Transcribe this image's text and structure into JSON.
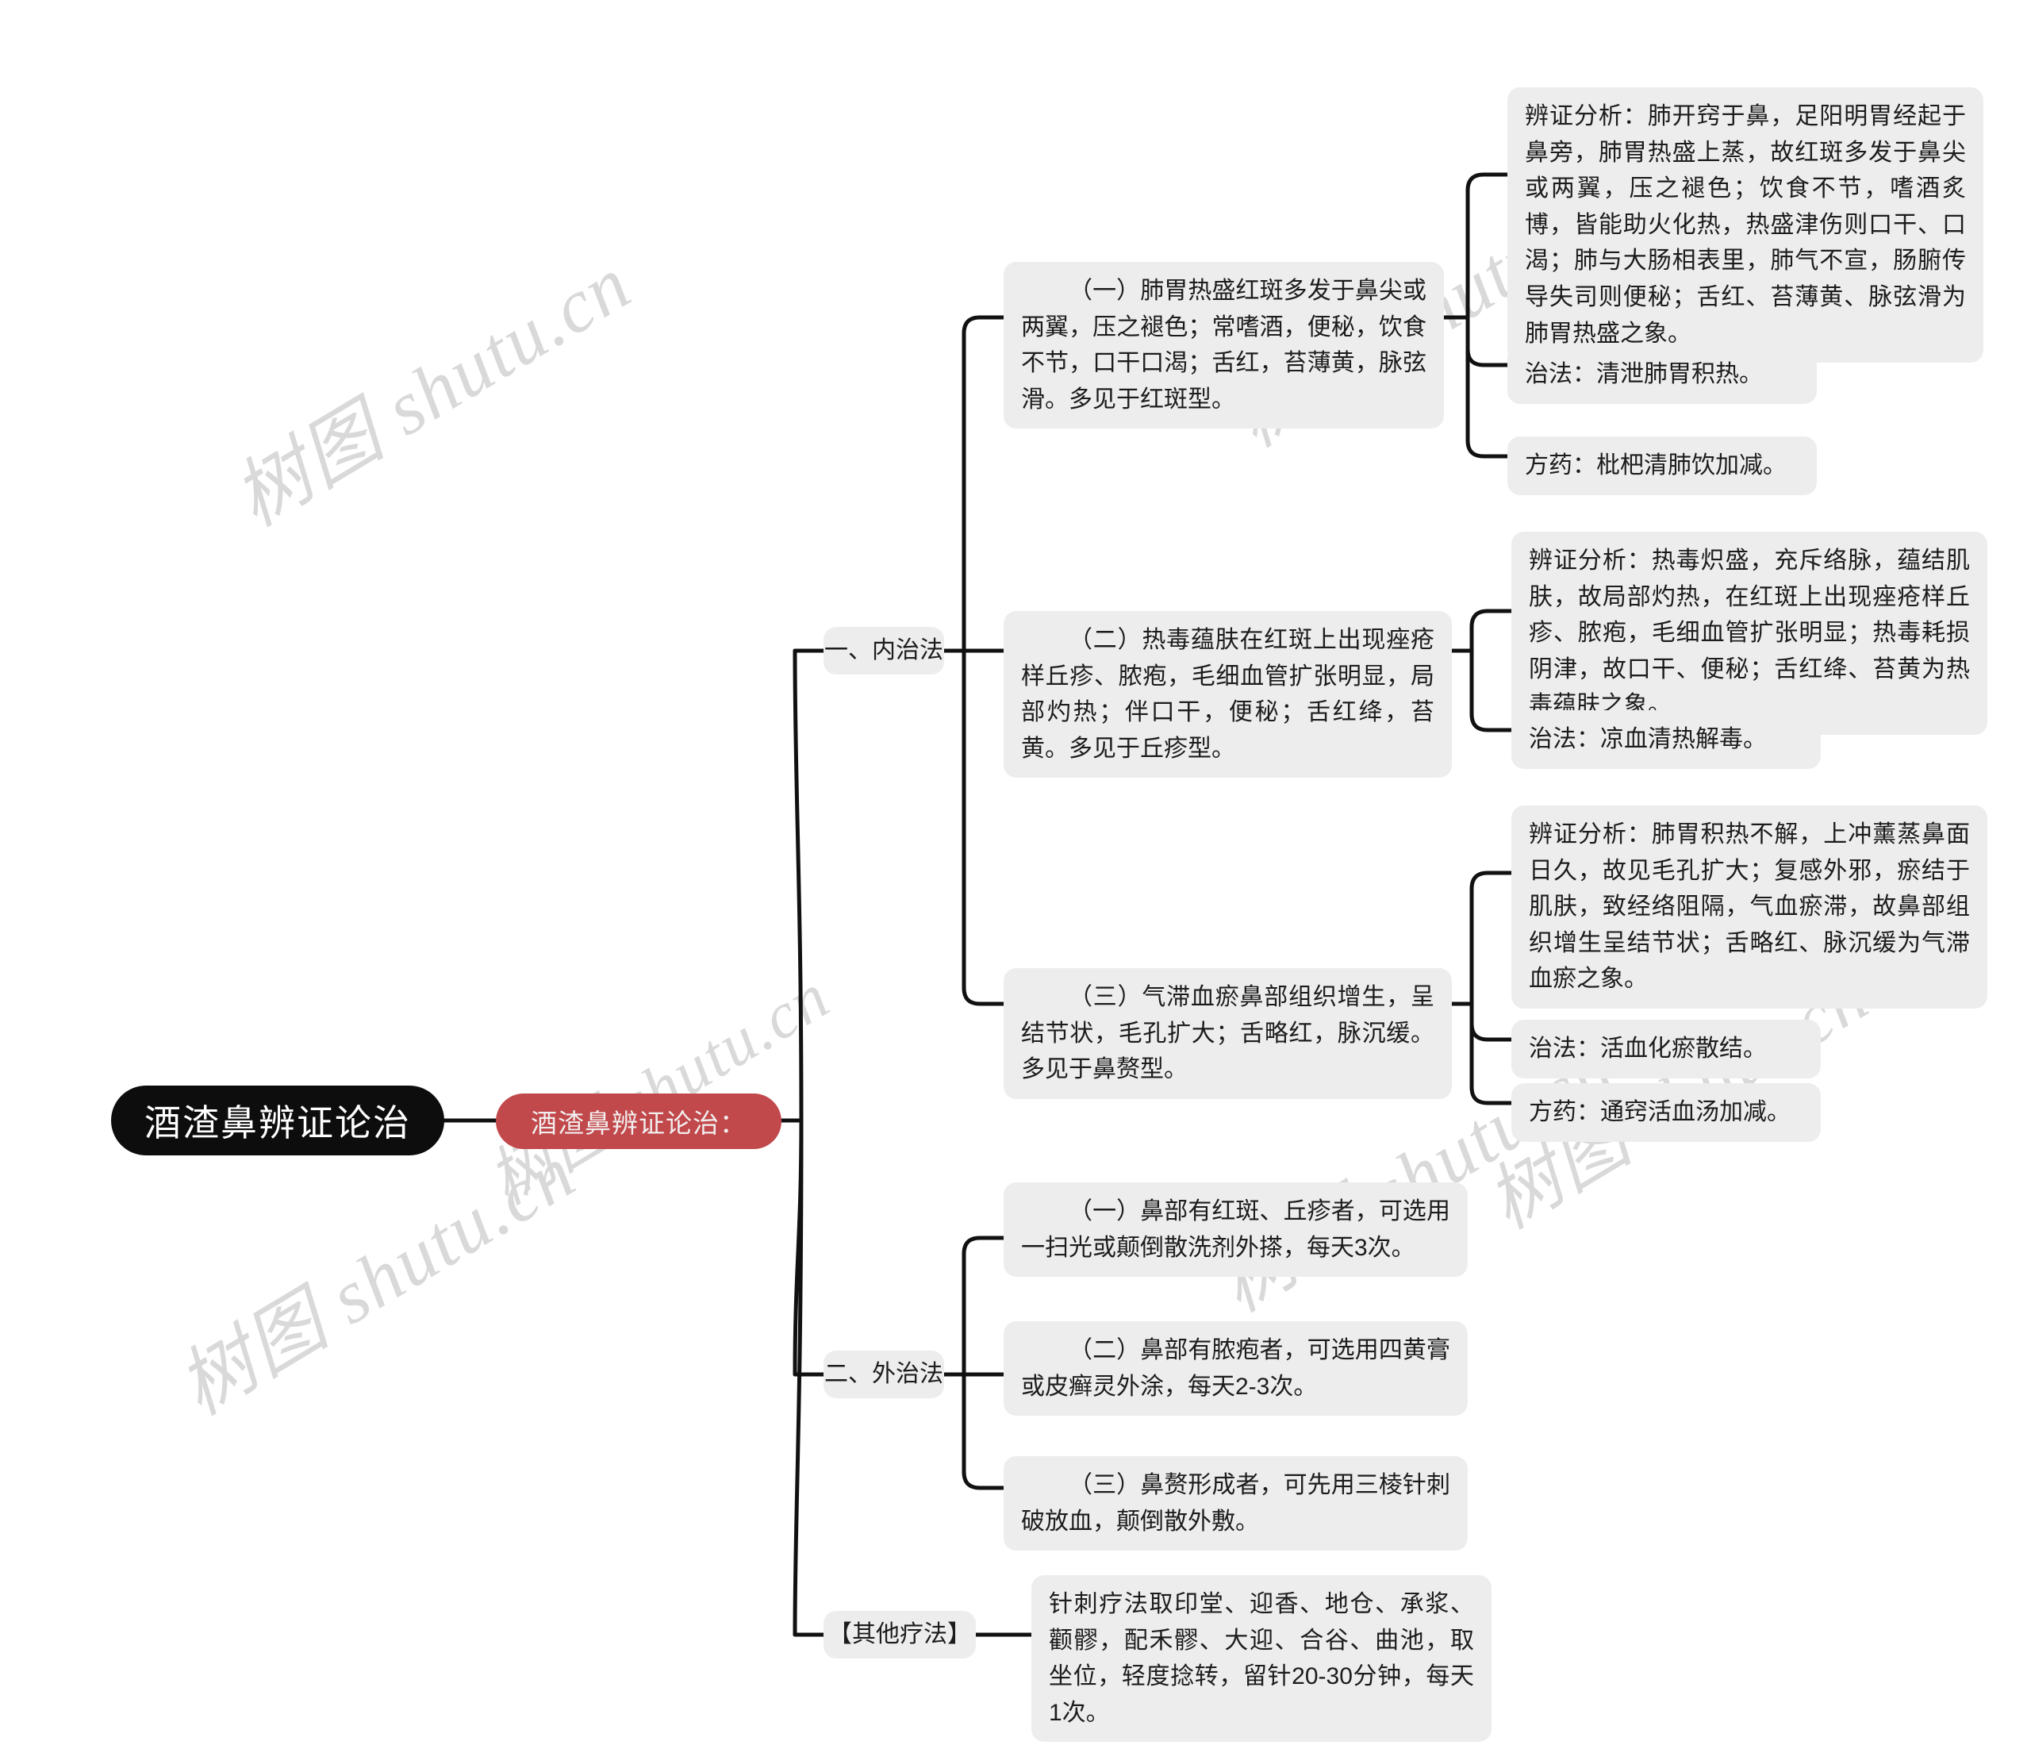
{
  "watermark": {
    "text": "树图 shutu.cn",
    "color": "#d9d9d9"
  },
  "theme": {
    "root_bg": "#0d0d0d",
    "root_fg": "#ffffff",
    "accent_bg": "#c1484b",
    "accent_fg": "#f2eeee",
    "node_bg": "#ededed",
    "node_fg": "#1c1c1c",
    "link": "#111111"
  },
  "root": {
    "label": "酒渣鼻辨证论治"
  },
  "topic": {
    "label": "酒渣鼻辨证论治："
  },
  "branches": [
    {
      "label": "一、内治法",
      "items": [
        {
          "text": "（一）肺胃热盛红斑多发于鼻尖或两翼，压之褪色；常嗜酒，便秘，饮食不节，口干口渴；舌红，苔薄黄，脉弦滑。多见于红斑型。",
          "details": [
            "辨证分析：肺开窍于鼻，足阳明胃经起于鼻旁，肺胃热盛上蒸，故红斑多发于鼻尖或两翼，压之褪色；饮食不节，嗜酒炙博，皆能助火化热，热盛津伤则口干、口渴；肺与大肠相表里，肺气不宣，肠腑传导失司则便秘；舌红、苔薄黄、脉弦滑为肺胃热盛之象。",
            "治法：清泄肺胃积热。",
            "方药：枇杷清肺饮加减。"
          ]
        },
        {
          "text": "（二）热毒蕴肤在红斑上出现痤疮样丘疹、脓疱，毛细血管扩张明显，局部灼热；伴口干，便秘；舌红绛，苔黄。多见于丘疹型。",
          "details": [
            "辨证分析：热毒炽盛，充斥络脉，蕴结肌肤，故局部灼热，在红斑上出现痤疮样丘疹、脓疱，毛细血管扩张明显；热毒耗损阴津，故口干、便秘；舌红绛、苔黄为热毒蕴肤之象。",
            "治法：凉血清热解毒。"
          ]
        },
        {
          "text": "（三）气滞血瘀鼻部组织增生，呈结节状，毛孔扩大；舌略红，脉沉缓。多见于鼻赘型。",
          "details": [
            "辨证分析：肺胃积热不解，上冲薰蒸鼻面日久，故见毛孔扩大；复感外邪，瘀结于肌肤，致经络阻隔，气血瘀滞，故鼻部组织增生呈结节状；舌略红、脉沉缓为气滞血瘀之象。",
            "治法：活血化瘀散结。",
            "方药：通窍活血汤加减。"
          ]
        }
      ]
    },
    {
      "label": "二、外治法",
      "items": [
        {
          "text": "（一）鼻部有红斑、丘疹者，可选用一扫光或颠倒散洗剂外搽，每天3次。",
          "details": []
        },
        {
          "text": "（二）鼻部有脓疱者，可选用四黄膏或皮癣灵外涂，每天2-3次。",
          "details": []
        },
        {
          "text": "（三）鼻赘形成者，可先用三棱针刺破放血，颠倒散外敷。",
          "details": []
        }
      ]
    },
    {
      "label": "【其他疗法】",
      "items": [
        {
          "text": "针刺疗法取印堂、迎香、地仓、承浆、颧髎，配禾髎、大迎、合谷、曲池，取坐位，轻度捻转，留针20-30分钟，每天1次。",
          "details": []
        }
      ]
    }
  ]
}
